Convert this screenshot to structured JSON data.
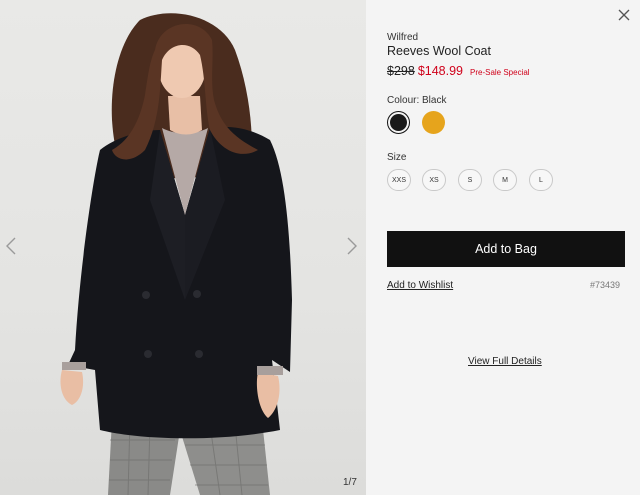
{
  "gallery": {
    "counter": "1/7",
    "image_alt": "Model wearing black double-breasted wool coat over grey sweater and plaid trousers"
  },
  "product": {
    "brand": "Wilfred",
    "name": "Reeves Wool Coat",
    "price_original": "$298",
    "price_sale": "$148.99",
    "promo": "Pre-Sale Special",
    "sku": "#73439"
  },
  "colour": {
    "label": "Colour: Black",
    "swatches": [
      {
        "name": "Black",
        "hex": "#1a1a1a",
        "selected": true
      },
      {
        "name": "Mustard",
        "hex": "#e6a41c",
        "selected": false
      }
    ]
  },
  "size": {
    "label": "Size",
    "options": [
      "XXS",
      "XS",
      "S",
      "M",
      "L"
    ]
  },
  "actions": {
    "add_to_bag": "Add to Bag",
    "add_to_wishlist": "Add to Wishlist",
    "view_full_details": "View Full Details"
  },
  "colors": {
    "sale_red": "#d0021b",
    "button_black": "#111111",
    "panel_bg": "#f4f4f4"
  }
}
